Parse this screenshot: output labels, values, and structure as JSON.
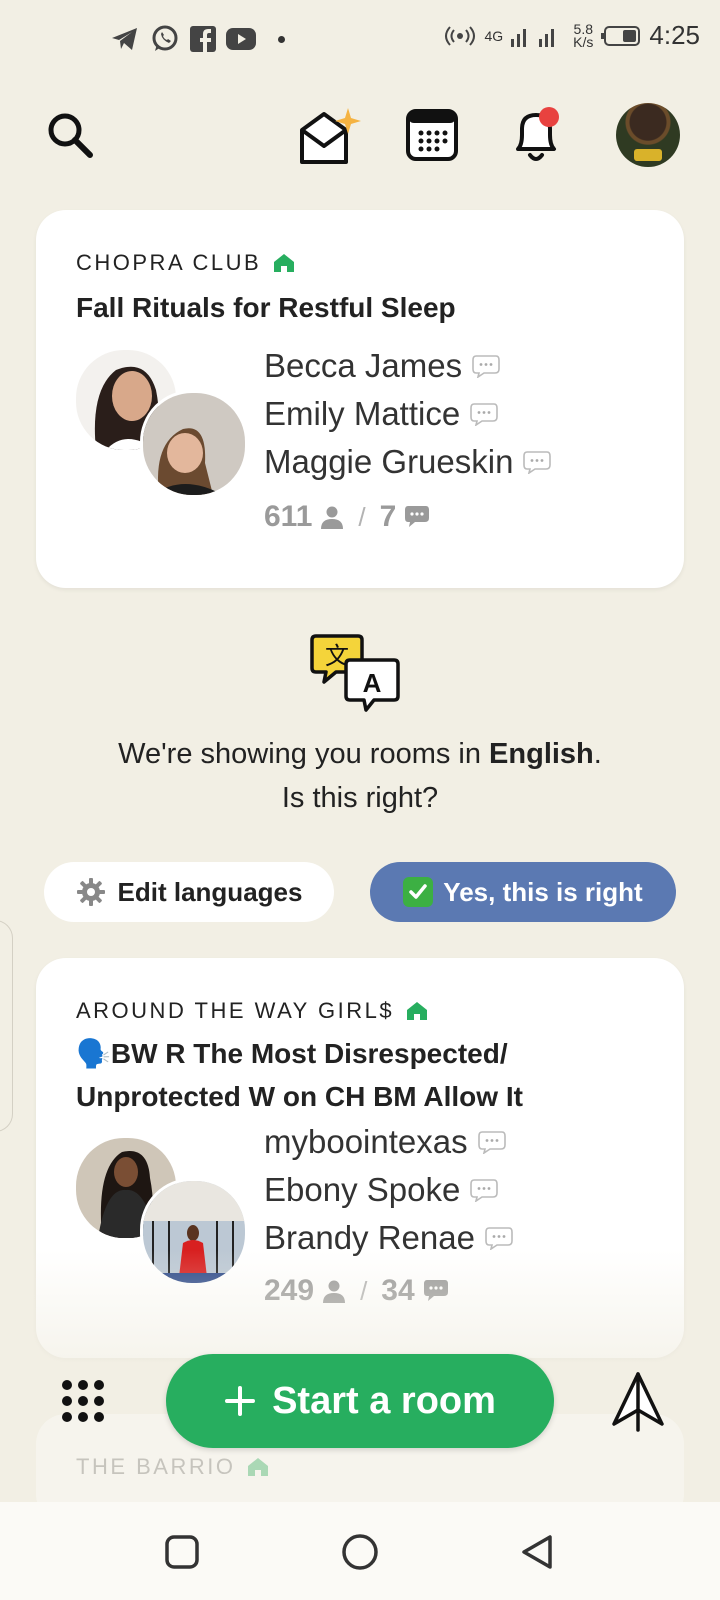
{
  "status_bar": {
    "time": "4:25",
    "network_speed": "5.8",
    "network_speed_unit": "K/s",
    "network_type": "4G",
    "notification_icons": [
      "telegram-icon",
      "whatsapp-icon",
      "facebook-icon",
      "youtube-icon"
    ]
  },
  "topbar": {
    "icons": [
      "search-icon",
      "invite-envelope-icon",
      "calendar-icon",
      "bell-icon",
      "profile-avatar"
    ],
    "notification_dot_color": "#e8423f"
  },
  "rooms": [
    {
      "club": "CHOPRA CLUB",
      "title": "Fall Rituals for Restful Sleep",
      "speakers": [
        "Becca James",
        "Emily Mattice",
        "Maggie Grueskin"
      ],
      "listeners": "611",
      "chats": "7"
    },
    {
      "club": "AROUND THE WAY GIRL$",
      "title_emoji": "🗣️",
      "title": "BW R The Most Disrespected/ Unprotected W on CH BM Allow It",
      "speakers": [
        "myboointexas",
        "Ebony Spoke",
        "Brandy Renae"
      ],
      "listeners": "249",
      "chats": "34"
    },
    {
      "club": "THE BARRIO"
    }
  ],
  "language_prompt": {
    "prefix": "We're showing you rooms in ",
    "language": "English",
    "suffix": ".",
    "question": "Is this right?",
    "edit_button": "Edit languages",
    "confirm_button": "Yes, this is right"
  },
  "actions": {
    "start_room": "Start a room"
  },
  "colors": {
    "background": "#f2efe4",
    "start_button": "#27ae5f",
    "confirm_button": "#5b79b2",
    "club_house": "#27ae5f"
  }
}
